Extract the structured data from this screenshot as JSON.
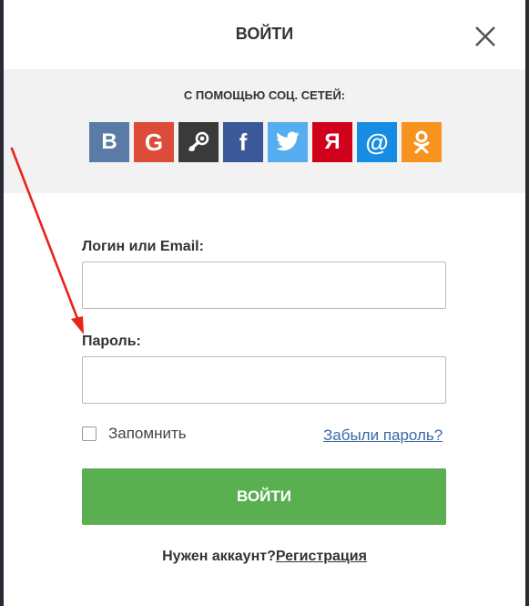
{
  "header": {
    "title": "ВОЙТИ"
  },
  "social": {
    "label": "С ПОМОЩЬЮ СОЦ. СЕТЕЙ:",
    "buttons": [
      {
        "name": "vk",
        "glyph": "B",
        "color": "#5a7ba6"
      },
      {
        "name": "google",
        "glyph": "G",
        "color": "#dd4b39"
      },
      {
        "name": "steam",
        "glyph": "",
        "color": "#3a3a3a"
      },
      {
        "name": "facebook",
        "glyph": "f",
        "color": "#3b5998"
      },
      {
        "name": "twitter",
        "glyph": "",
        "color": "#55acee"
      },
      {
        "name": "yandex",
        "glyph": "Я",
        "color": "#d0021b"
      },
      {
        "name": "mailru",
        "glyph": "@",
        "color": "#168de2"
      },
      {
        "name": "odnoklassniki",
        "glyph": "",
        "color": "#f7931e"
      }
    ]
  },
  "form": {
    "login_label": "Логин или Email:",
    "login_value": "",
    "password_label": "Пароль:",
    "password_value": "",
    "remember_label": "Запомнить",
    "forgot_label": "Забыли пароль?",
    "submit_label": "ВОЙТИ",
    "need_account": "Нужен аккаунт?",
    "register_label": "Регистрация"
  },
  "colors": {
    "submit": "#5aaf51",
    "link": "#3a6aa5",
    "annotation_arrow": "#e8231c"
  }
}
